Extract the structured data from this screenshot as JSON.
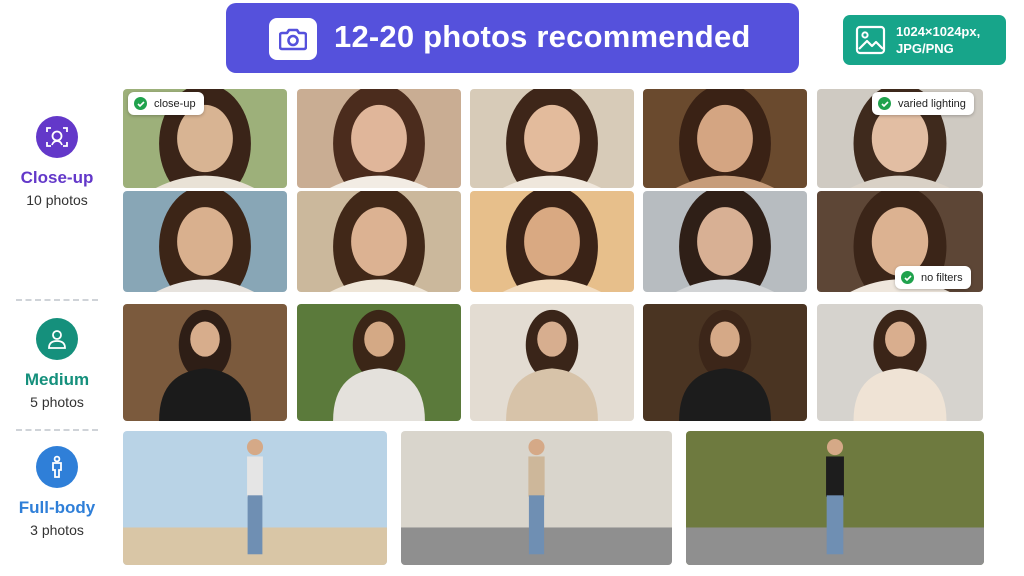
{
  "header": {
    "title": "12-20 photos recommended",
    "icon": "camera-icon",
    "color": "#5551dc"
  },
  "spec": {
    "line1": "1024×1024px,",
    "line2": "JPG/PNG",
    "icon": "image-icon",
    "color": "#17a58a"
  },
  "sections": [
    {
      "name": "Close-up",
      "count": "10 photos",
      "color": "#6338c9",
      "icon": "face-scan-icon"
    },
    {
      "name": "Medium",
      "count": "5 photos",
      "color": "#15907c",
      "icon": "upper-body-icon"
    },
    {
      "name": "Full-body",
      "count": "3 photos",
      "color": "#2f7fd8",
      "icon": "full-body-icon"
    }
  ],
  "tags": {
    "closeup": "close-up",
    "lighting": "varied lighting",
    "filters": "no filters"
  }
}
